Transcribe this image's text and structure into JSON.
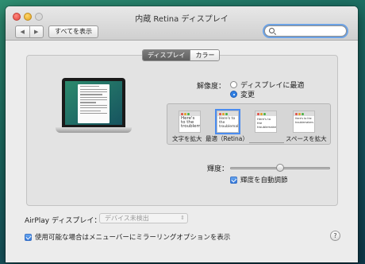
{
  "window": {
    "title": "内蔵 Retina ディスプレイ",
    "back_glyph": "◀",
    "forward_glyph": "▶",
    "show_all_label": "すべてを表示",
    "search": {
      "value": "",
      "placeholder": ""
    }
  },
  "tabs": [
    {
      "label": "ディスプレイ",
      "selected": true
    },
    {
      "label": "カラー",
      "selected": false
    }
  ],
  "display": {
    "laptop_screen_text": "Here's to the crazy ones...",
    "resolution": {
      "label": "解像度：",
      "options": [
        {
          "label": "ディスプレイに最適",
          "selected": false
        },
        {
          "label": "変更",
          "selected": true
        }
      ]
    },
    "scale": {
      "thumb_text": "Here's to the troublemakers",
      "labels": {
        "larger_text": "文字を拡大",
        "best": "最適（Retina）",
        "more_space": "スペースを拡大"
      },
      "selected_index": 1
    },
    "brightness": {
      "label": "輝度：",
      "level": 0.5,
      "auto_label": "輝度を自動調節",
      "auto_checked": true
    }
  },
  "airplay": {
    "label": "AirPlay ディスプレイ：",
    "selected": "デバイス未検出"
  },
  "mirroring": {
    "label": "使用可能な場合はメニューバーにミラーリングオプションを表示",
    "checked": true
  },
  "help_glyph": "?",
  "colors": {
    "accent": "#2f7fe3",
    "close": "#e0443e",
    "minimize": "#e0a020",
    "selected_tab": "#6a6a6a"
  },
  "icons": [
    "close-icon",
    "minimize-icon",
    "zoom-icon",
    "back-icon",
    "forward-icon",
    "search-icon",
    "help-icon",
    "checkmark-icon"
  ]
}
